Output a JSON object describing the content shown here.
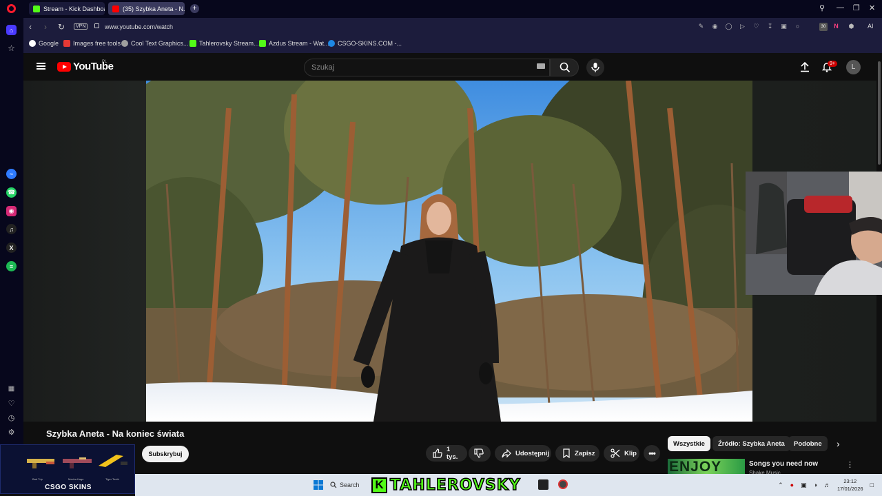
{
  "browser": {
    "tabs": [
      {
        "label": "Stream - Kick Dashboard",
        "icon": "kick-icon"
      },
      {
        "label": "(35) Szybka Aneta - N...",
        "icon": "youtube-icon"
      }
    ],
    "url": "www.youtube.com/watch",
    "vpn_label": "VPN",
    "bookmarks": [
      {
        "label": "Google",
        "icon": "google-icon"
      },
      {
        "label": "Images free tools",
        "icon": "images-icon"
      },
      {
        "label": "Cool Text Graphics...",
        "icon": "cooltext-icon"
      },
      {
        "label": "Tahlerovsky Stream...",
        "icon": "kick-icon"
      },
      {
        "label": "Azdus Stream - Wat...",
        "icon": "kick-icon"
      },
      {
        "label": "CSGO-SKINS.COM -...",
        "icon": "csgo-icon"
      }
    ],
    "ext_badge": "30",
    "ai_label": "AI"
  },
  "youtube": {
    "logo_text": "YouTube",
    "country_code": "PL",
    "search_placeholder": "Szukaj",
    "notifications_badge": "9+",
    "avatar_letter": "L",
    "video_title": "Szybka Aneta - Na koniec świata",
    "subscribe_label": "Subskrybuj",
    "like_count": "1 tys.",
    "share_label": "Udostępnij",
    "save_label": "Zapisz",
    "clip_label": "Klip",
    "chips": [
      "Wszystkie",
      "Źródło: Szybka Aneta",
      "Podobne"
    ],
    "recommendation": {
      "title": "Songs you need now",
      "channel": "Shake Music",
      "thumb_text": "ENJOY"
    }
  },
  "overlay": {
    "brand": "CSGO SKINS",
    "items": [
      "Bad Trip",
      "Mecha Kage",
      "Tiger Tooth"
    ]
  },
  "taskbar": {
    "search_label": "Search",
    "streamer_banner": "TAHLEROVSKY",
    "time": "23:12",
    "date": "17/01/2026"
  },
  "colors": {
    "youtube_red": "#ff0000",
    "kick_green": "#53fc18",
    "opera_red": "#ff1b2d"
  }
}
